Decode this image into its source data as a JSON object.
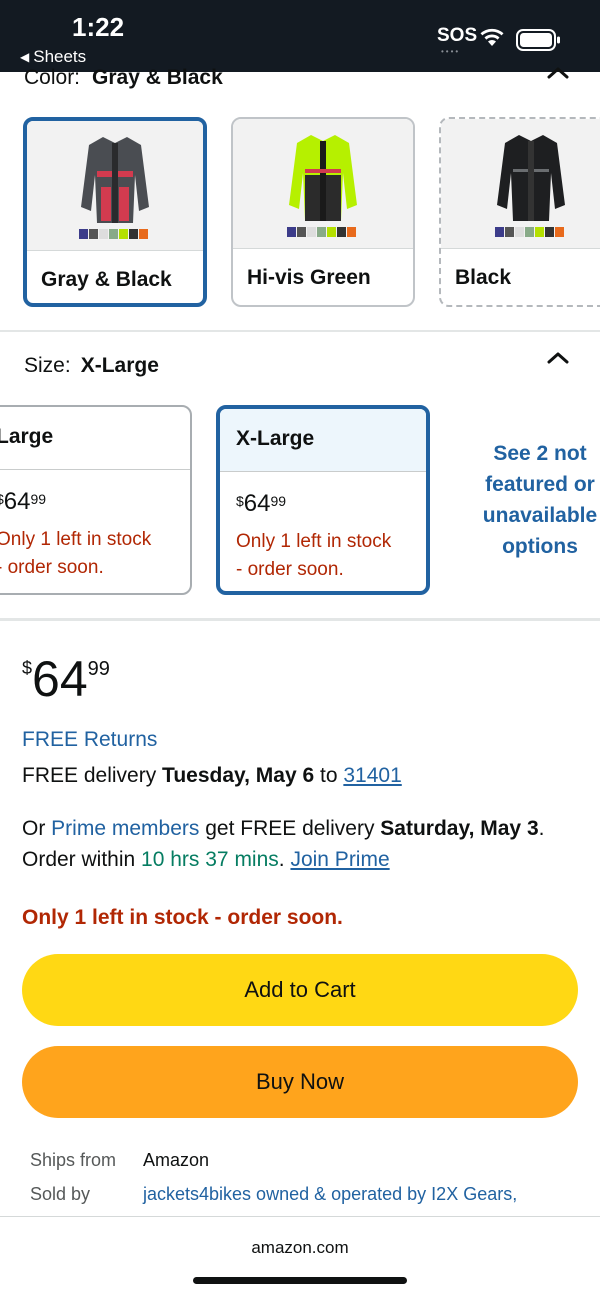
{
  "status_bar": {
    "time": "1:22",
    "back_app": "Sheets",
    "sos": "SOS",
    "sos_dots": "••••"
  },
  "color_selector": {
    "label": "Color:",
    "selected_value": "Gray & Black",
    "options": [
      {
        "label": "Gray & Black",
        "selected": true,
        "jacket_accent": "#d23b4f",
        "jacket_body": "#4a4d52"
      },
      {
        "label": "Hi-vis Green",
        "selected": false,
        "jacket_accent": "#b6f000",
        "jacket_body": "#2b2b2b"
      },
      {
        "label": "Black",
        "selected": false,
        "jacket_accent": "#6a6d70",
        "jacket_body": "#1e1f21"
      }
    ]
  },
  "size_selector": {
    "label": "Size:",
    "selected_value": "X-Large",
    "options": [
      {
        "label": "Large",
        "currency": "$",
        "whole": "64",
        "cents": "99",
        "stock_line1": "Only 1 left in stock",
        "stock_line2": "- order soon.",
        "selected": false
      },
      {
        "label": "X-Large",
        "currency": "$",
        "whole": "64",
        "cents": "99",
        "stock_line1": "Only 1 left in stock",
        "stock_line2": "- order soon.",
        "selected": true
      }
    ],
    "see_more": [
      "See 2 not",
      "featured or",
      "unavailable",
      "options"
    ]
  },
  "price": {
    "currency": "$",
    "whole": "64",
    "cents": "99"
  },
  "free_returns": "FREE Returns",
  "delivery": {
    "prefix": "FREE delivery ",
    "date": "Tuesday, May 6",
    "to": " to ",
    "zip": "31401"
  },
  "prime": {
    "or": "Or ",
    "members": "Prime members",
    "get": " get FREE delivery ",
    "date": "Saturday, May 3",
    "order_within": ". Order within ",
    "countdown": "10 hrs 37 mins",
    "period": ". ",
    "join": "Join Prime"
  },
  "stock_notice": "Only 1 left in stock - order soon.",
  "buttons": {
    "add_to_cart": "Add to Cart",
    "buy_now": "Buy Now"
  },
  "ships_from": {
    "label": "Ships from",
    "value": "Amazon"
  },
  "sold_by": {
    "label": "Sold by",
    "value": "jackets4bikes owned & operated by I2X Gears,"
  },
  "footer": {
    "domain": "amazon.com"
  },
  "colors": {
    "link": "#2162a1",
    "alert": "#b12704",
    "cart": "#ffd814",
    "buy": "#ffa41c",
    "selected_border": "#2162a1"
  }
}
